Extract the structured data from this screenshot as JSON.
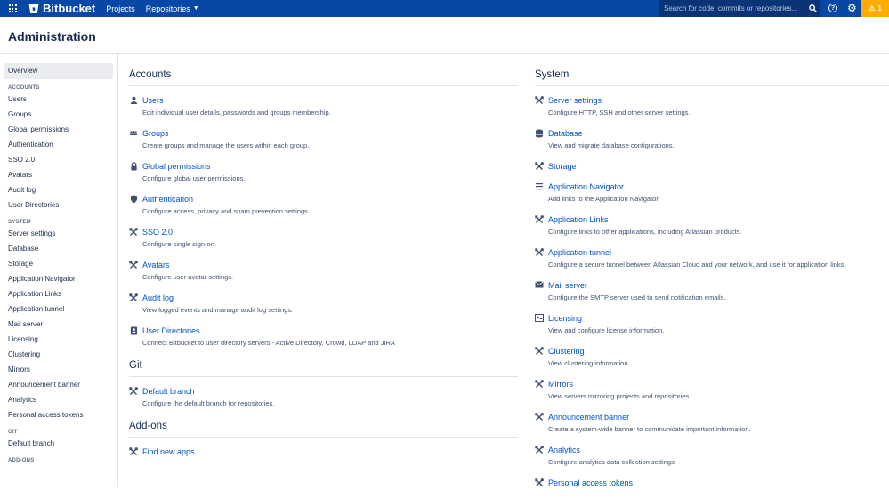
{
  "header": {
    "brand": "Bitbucket",
    "projects": "Projects",
    "repositories": "Repositories",
    "search_placeholder": "Search for code, commits or repositories...",
    "alert_count": "1"
  },
  "page_title": "Administration",
  "sidebar": {
    "overview": "Overview",
    "accounts_heading": "ACCOUNTS",
    "accounts": [
      "Users",
      "Groups",
      "Global permissions",
      "Authentication",
      "SSO 2.0",
      "Avatars",
      "Audit log",
      "User Directories"
    ],
    "system_heading": "SYSTEM",
    "system": [
      "Server settings",
      "Database",
      "Storage",
      "Application Navigator",
      "Application Links",
      "Application tunnel",
      "Mail server",
      "Licensing",
      "Clustering",
      "Mirrors",
      "Announcement banner",
      "Analytics",
      "Personal access tokens"
    ],
    "git_heading": "GIT",
    "git": [
      "Default branch"
    ],
    "addons_heading": "ADD-ONS"
  },
  "accounts": {
    "title": "Accounts",
    "items": [
      {
        "label": "Users",
        "desc": "Edit individual user details, passwords and groups membership.",
        "icon": "user-icon"
      },
      {
        "label": "Groups",
        "desc": "Create groups and manage the users within each group.",
        "icon": "group-icon"
      },
      {
        "label": "Global permissions",
        "desc": "Configure global user permissions.",
        "icon": "lock-icon"
      },
      {
        "label": "Authentication",
        "desc": "Configure access, privacy and spam prevention settings.",
        "icon": "shield-icon"
      },
      {
        "label": "SSO 2.0",
        "desc": "Configure single sign-on.",
        "icon": "tools-icon"
      },
      {
        "label": "Avatars",
        "desc": "Configure user avatar settings.",
        "icon": "tools-icon"
      },
      {
        "label": "Audit log",
        "desc": "View logged events and manage audit log settings.",
        "icon": "tools-icon"
      },
      {
        "label": "User Directories",
        "desc": "Connect Bitbucket to user directory servers - Active Directory, Crowd, LDAP and JIRA",
        "icon": "directory-icon"
      }
    ]
  },
  "git": {
    "title": "Git",
    "items": [
      {
        "label": "Default branch",
        "desc": "Configure the default branch for repositories.",
        "icon": "tools-icon"
      }
    ]
  },
  "addons": {
    "title": "Add-ons",
    "items": [
      {
        "label": "Find new apps",
        "icon": "tools-icon"
      }
    ]
  },
  "system": {
    "title": "System",
    "items": [
      {
        "label": "Server settings",
        "desc": "Configure HTTP, SSH and other server settings.",
        "icon": "tools-icon"
      },
      {
        "label": "Database",
        "desc": "View and migrate database configurations.",
        "icon": "database-icon"
      },
      {
        "label": "Storage",
        "desc": "",
        "icon": "tools-icon"
      },
      {
        "label": "Application Navigator",
        "desc": "Add links to the Application Navigator",
        "icon": "list-icon"
      },
      {
        "label": "Application Links",
        "desc": "Configure links to other applications, including Atlassian products.",
        "icon": "tools-icon"
      },
      {
        "label": "Application tunnel",
        "desc": "Configure a secure tunnel between Atlassian Cloud and your network, and use it for application links.",
        "icon": "tools-icon"
      },
      {
        "label": "Mail server",
        "desc": "Configure the SMTP server used to send notification emails.",
        "icon": "mail-icon"
      },
      {
        "label": "Licensing",
        "desc": "View and configure license information.",
        "icon": "license-icon"
      },
      {
        "label": "Clustering",
        "desc": "View clustering information.",
        "icon": "tools-icon"
      },
      {
        "label": "Mirrors",
        "desc": "View servers mirroring projects and repositories",
        "icon": "tools-icon"
      },
      {
        "label": "Announcement banner",
        "desc": "Create a system-wide banner to communicate important information.",
        "icon": "tools-icon"
      },
      {
        "label": "Analytics",
        "desc": "Configure analytics data collection settings.",
        "icon": "tools-icon"
      },
      {
        "label": "Personal access tokens",
        "desc": "",
        "icon": "tools-icon"
      }
    ]
  }
}
